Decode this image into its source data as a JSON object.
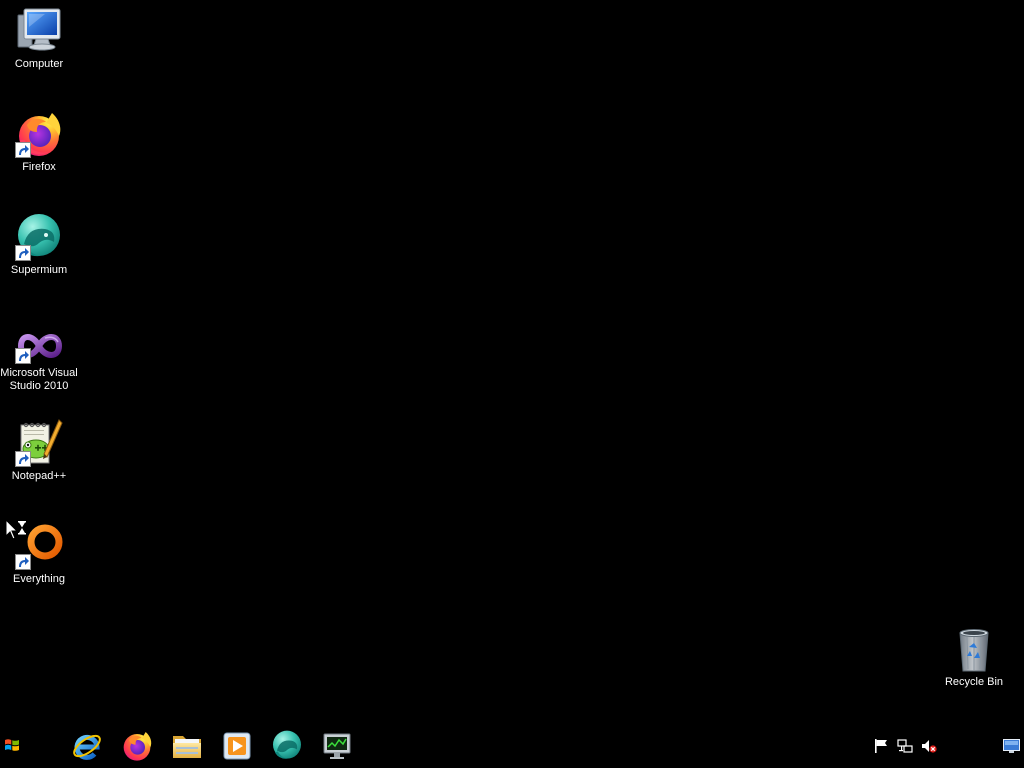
{
  "desktop": {
    "background_color": "#000000",
    "label_color": "#ffffff",
    "icons": [
      {
        "label": "Computer",
        "icon": "computer-icon",
        "shortcut": false
      },
      {
        "label": "Firefox",
        "icon": "firefox-icon",
        "shortcut": true
      },
      {
        "label": "Supermium",
        "icon": "supermium-icon",
        "shortcut": true
      },
      {
        "label": "Microsoft Visual Studio 2010",
        "icon": "visual-studio-icon",
        "shortcut": true
      },
      {
        "label": "Notepad++",
        "icon": "notepad-plus-plus-icon",
        "shortcut": true
      },
      {
        "label": "Everything",
        "icon": "everything-icon",
        "shortcut": true
      }
    ],
    "recycle_bin": {
      "label": "Recycle Bin",
      "icon": "recycle-bin-icon"
    }
  },
  "cursor": {
    "icon": "busy-arrow-cursor-icon"
  },
  "taskbar": {
    "background_color": "#000000",
    "start": {
      "icon": "windows-start-icon"
    },
    "pinned": [
      {
        "icon": "internet-explorer-icon"
      },
      {
        "icon": "firefox-icon"
      },
      {
        "icon": "file-explorer-icon"
      },
      {
        "icon": "media-player-icon"
      },
      {
        "icon": "supermium-icon"
      },
      {
        "icon": "monitor-icon"
      }
    ],
    "tray": [
      {
        "icon": "action-center-flag-icon"
      },
      {
        "icon": "network-icon"
      },
      {
        "icon": "volume-muted-icon"
      }
    ],
    "show_desktop": {
      "icon": "show-desktop-icon"
    }
  }
}
